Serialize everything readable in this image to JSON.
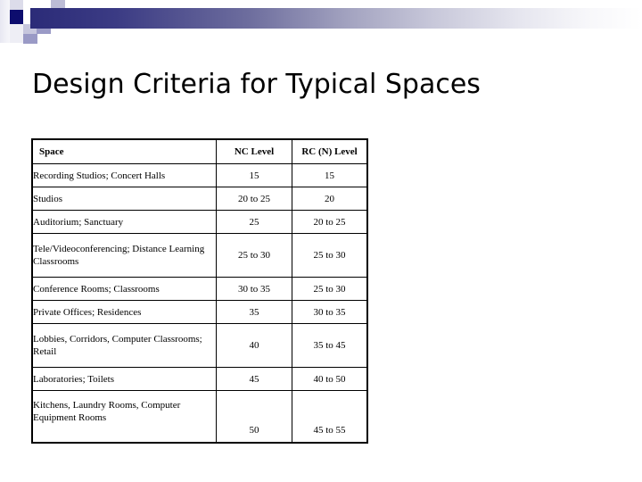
{
  "slide": {
    "title": "Design Criteria for Typical Spaces",
    "background_color": "#ffffff"
  },
  "banner": {
    "accent_dark": "#20207a",
    "accent_mid": "#9a9ac4",
    "accent_light": "#c5c5de",
    "accent_pale": "#e2e2ee",
    "gradient_from": "#2b2b78",
    "gradient_to": "#ffffff"
  },
  "table": {
    "columns": [
      "Space",
      "NC Level",
      "RC (N) Level"
    ],
    "rows": [
      {
        "space": "Recording Studios; Concert Halls",
        "nc": "15",
        "rc": "15",
        "tall": false
      },
      {
        "space": "Studios",
        "nc": "20 to 25",
        "rc": "20",
        "tall": false
      },
      {
        "space": "Auditorium; Sanctuary",
        "nc": "25",
        "rc": "20 to 25",
        "tall": false
      },
      {
        "space": "Tele/Videoconferencing; Distance Learning Classrooms",
        "nc": "25 to 30",
        "rc": "25 to 30",
        "tall": true
      },
      {
        "space": "Conference Rooms; Classrooms",
        "nc": "30 to 35",
        "rc": "25 to 30",
        "tall": false
      },
      {
        "space": "Private Offices; Residences",
        "nc": "35",
        "rc": "30 to 35",
        "tall": false
      },
      {
        "space": "Lobbies, Corridors, Computer Classrooms; Retail",
        "nc": "40",
        "rc": "35 to 45",
        "tall": true
      },
      {
        "space": "Laboratories; Toilets",
        "nc": "45",
        "rc": "40 to 50",
        "tall": false
      },
      {
        "space": "Kitchens, Laundry Rooms, Computer Equipment Rooms",
        "nc": "50",
        "rc": "45 to 55",
        "tall": true
      }
    ]
  }
}
